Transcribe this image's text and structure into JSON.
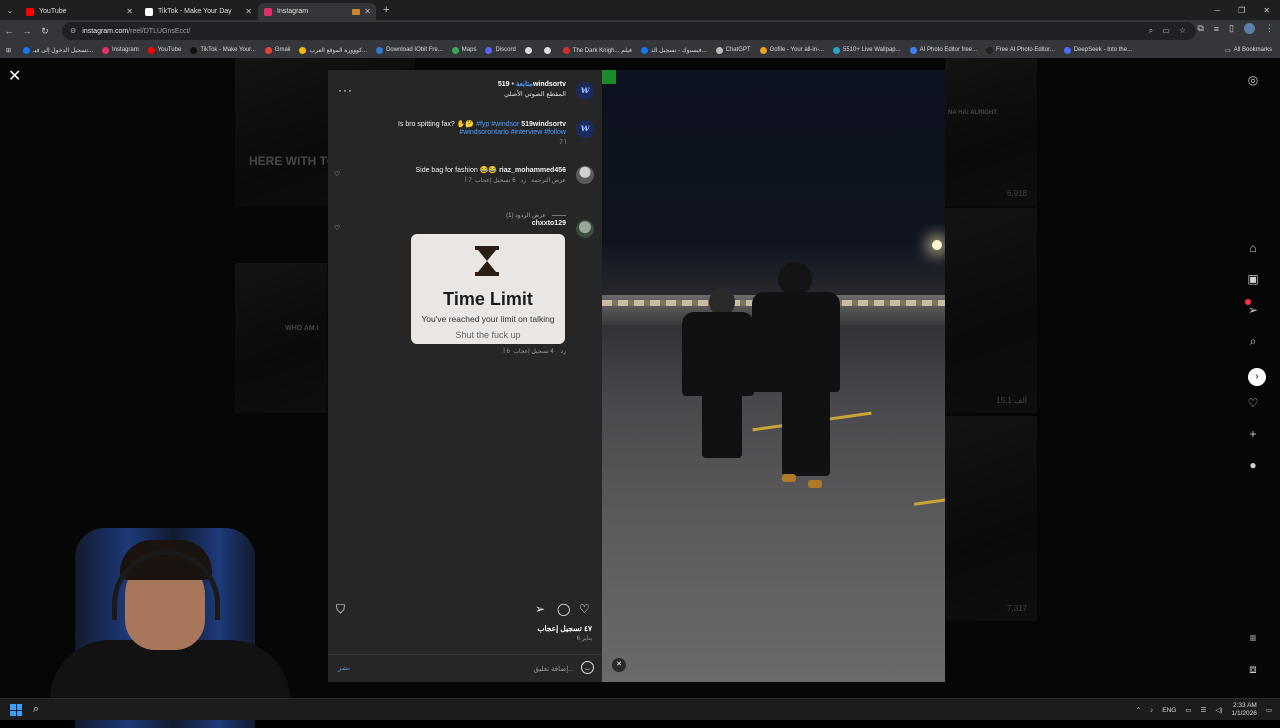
{
  "browser": {
    "tabs": [
      {
        "label": "YouTube",
        "color": "#ff0000",
        "active": false
      },
      {
        "label": "TikTok - Make Your Day",
        "color": "#111111",
        "active": false
      },
      {
        "label": "Instagram",
        "color": "#e1306c",
        "active": true
      }
    ],
    "new_tab_symbol": "+",
    "url_host": "instagram.com",
    "url_path": "/reel/DTLUGnsEcct/",
    "bookmarks": [
      {
        "label": "تسجيل الدخول إلى فيـ...",
        "color": "#1877f2"
      },
      {
        "label": "Instagram",
        "color": "#e1306c"
      },
      {
        "label": "YouTube",
        "color": "#ff0000"
      },
      {
        "label": "TikTok - Make Your...",
        "color": "#111111"
      },
      {
        "label": "Gmail",
        "color": "#ea4335"
      },
      {
        "label": "كووورة الموقع العرب...",
        "color": "#f2b705"
      },
      {
        "label": "Download IObit Fre...",
        "color": "#2d7ad6"
      },
      {
        "label": "Maps",
        "color": "#34a853"
      },
      {
        "label": "Discord",
        "color": "#5865f2"
      },
      {
        "label": "",
        "color": "#dddddd"
      },
      {
        "label": "",
        "color": "#dddddd"
      },
      {
        "label": "The Dark Knigh... فيلم",
        "color": "#d32f2f"
      },
      {
        "label": "فيسبوك - تسجيل الد...",
        "color": "#1877f2"
      },
      {
        "label": "ChatGPT",
        "color": "#bbbbbb"
      },
      {
        "label": "Gofile - Your all-in-...",
        "color": "#f0a020"
      },
      {
        "label": "5510+ Live Wallpap...",
        "color": "#2aa3c9"
      },
      {
        "label": "AI Photo Editor free...",
        "color": "#3b82f6"
      },
      {
        "label": "Free AI Photo Editor...",
        "color": "#222222"
      },
      {
        "label": "DeepSeek - Into the...",
        "color": "#4d6bfe"
      }
    ],
    "all_bookmarks": "All Bookmarks"
  },
  "background_thumbs": [
    {
      "caption": "HERE WITH TO",
      "count": ""
    },
    {
      "caption": "NA HA! ALRIGHT.",
      "count": "6,918"
    },
    {
      "caption": "WHO AM I",
      "count": ""
    },
    {
      "caption": "",
      "count": "15.1 ألف"
    },
    {
      "caption": "",
      "count": "7,317"
    }
  ],
  "post": {
    "username": "519windsortv",
    "follow_label": "متابعة",
    "separator": "•",
    "audio_label": "المقطع الصوتي الأصلي",
    "caption": {
      "user": "519windsortv",
      "text": "Is bro spitting fax? ✋🤔",
      "hashtags_line1": "#fyp #windsor",
      "hashtags_line2": "#windsorontario #interview #follow",
      "age": "7 أ"
    },
    "comments": [
      {
        "user": "riaz_mohammed456",
        "text": "Side bag for fashion 😂😂",
        "age": "7 أ",
        "likes": "6 تسجيل إعجاب",
        "reply": "رد",
        "translate": "عرض الترجمة"
      },
      {
        "user": "chxxto129",
        "age": "6 أ",
        "likes": "4 تسجيل إعجاب",
        "reply": "رد"
      }
    ],
    "view_replies": "عرض الردود (1)",
    "sticker": {
      "title": "Time Limit",
      "message": "You've reached your limit on talking",
      "sub": "Shut the fuck up"
    },
    "likes_label": "٤٧ تسجيل إعجاب",
    "date": "6 يناير",
    "post_button": "نشر",
    "comment_placeholder": "إضافة تعليق..."
  },
  "taskbar": {
    "lang": "ENG",
    "time": "2:33 AM",
    "date": "1/1/2026"
  }
}
